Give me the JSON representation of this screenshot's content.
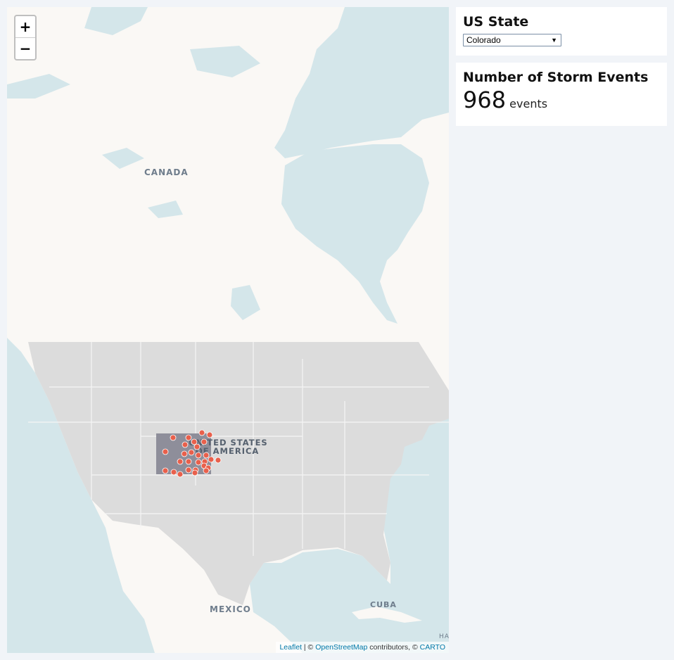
{
  "map": {
    "zoom_in_label": "+",
    "zoom_out_label": "−",
    "labels": {
      "canada": "CANADA",
      "usa_line1": "UNITED STATES",
      "usa_line2": "OF AMERICA",
      "mexico": "MEXICO",
      "cuba": "CUBA",
      "edge": "HA"
    },
    "attribution": {
      "leaflet": "Leaflet",
      "sep": " | © ",
      "osm": "OpenStreetMap",
      "contrib": " contributors, © ",
      "carto": "CARTO"
    },
    "colors": {
      "water": "#d4e6ea",
      "land": "#faf8f5",
      "us_overlay": "#dcdcdc",
      "highlight_state": "#8e8e9a",
      "marker": "#e8604c"
    }
  },
  "state_panel": {
    "title": "US State",
    "selected": "Colorado"
  },
  "events_panel": {
    "title": "Number of Storm Events",
    "count": "968",
    "unit": "events"
  }
}
